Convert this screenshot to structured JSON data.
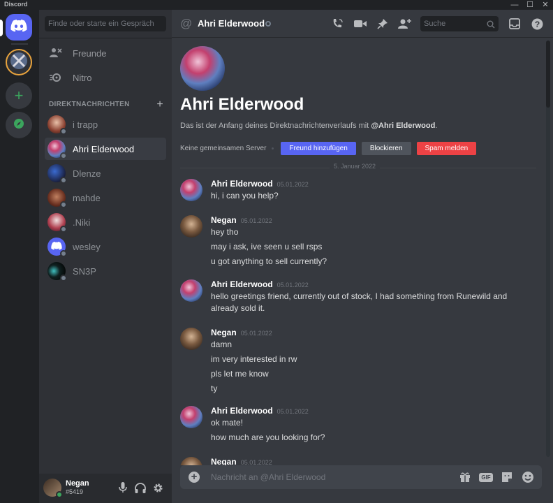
{
  "window": {
    "title": "Discord",
    "controls": [
      "—",
      "☐",
      "✕"
    ]
  },
  "sidebar": {
    "search_placeholder": "Finde oder starte ein Gespräch",
    "nav": [
      {
        "label": "Freunde",
        "icon": "friends-icon"
      },
      {
        "label": "Nitro",
        "icon": "nitro-icon"
      }
    ],
    "dm_header": "DIREKTNACHRICHTEN",
    "dms": [
      {
        "name": "i trapp",
        "status": "offline",
        "active": false
      },
      {
        "name": "Ahri Elderwood",
        "status": "offline",
        "active": true
      },
      {
        "name": "Dlenze",
        "status": "offline",
        "active": false
      },
      {
        "name": "mahde",
        "status": "offline",
        "active": false
      },
      {
        "name": ".Niki",
        "status": "offline",
        "active": false
      },
      {
        "name": "wesley",
        "status": "offline",
        "active": false
      },
      {
        "name": "SN3P",
        "status": "offline",
        "active": false
      }
    ],
    "user": {
      "name": "Negan",
      "tag": "#5419",
      "status": "online"
    }
  },
  "chat": {
    "header": {
      "name": "Ahri Elderwood",
      "search_placeholder": "Suche"
    },
    "intro": {
      "title": "Ahri Elderwood",
      "desc_prefix": "Das ist der Anfang deines Direktnachrichtenverlaufs mit ",
      "desc_user": "@Ahri Elderwood",
      "desc_suffix": ".",
      "no_servers": "Keine gemeinsamen Server",
      "add_friend": "Freund hinzufügen",
      "block": "Blockieren",
      "report": "Spam melden"
    },
    "date_divider": "5. Januar 2022",
    "messages": [
      {
        "author": "Ahri Elderwood",
        "avatar": "ahri",
        "time": "05.01.2022",
        "lines": [
          "hi, i can you help?"
        ]
      },
      {
        "author": "Negan",
        "avatar": "negan",
        "time": "05.01.2022",
        "lines": [
          "hey tho",
          "may i ask, ive seen u sell rsps",
          "u got anything to sell currently?"
        ]
      },
      {
        "author": "Ahri Elderwood",
        "avatar": "ahri",
        "time": "05.01.2022",
        "lines": [
          "hello greetings friend, currently out of stock, I had something from Runewild and already sold it."
        ]
      },
      {
        "author": "Negan",
        "avatar": "negan",
        "time": "05.01.2022",
        "lines": [
          "damn",
          "im very interested in rw",
          "pls let me know",
          "ty"
        ]
      },
      {
        "author": "Ahri Elderwood",
        "avatar": "ahri",
        "time": "05.01.2022",
        "lines": [
          "ok mate!",
          "how much are you looking for?"
        ]
      },
      {
        "author": "Negan",
        "avatar": "negan",
        "time": "05.01.2022",
        "lines": []
      }
    ],
    "composer": {
      "placeholder": "Nachricht an @Ahri Elderwood",
      "gif_label": "GIF"
    }
  },
  "colors": {
    "blurple": "#5865f2",
    "danger": "#ed4245",
    "online": "#3ba55d",
    "bg_chat": "#36393f",
    "bg_sidebar": "#2f3136",
    "bg_rail": "#202225"
  }
}
